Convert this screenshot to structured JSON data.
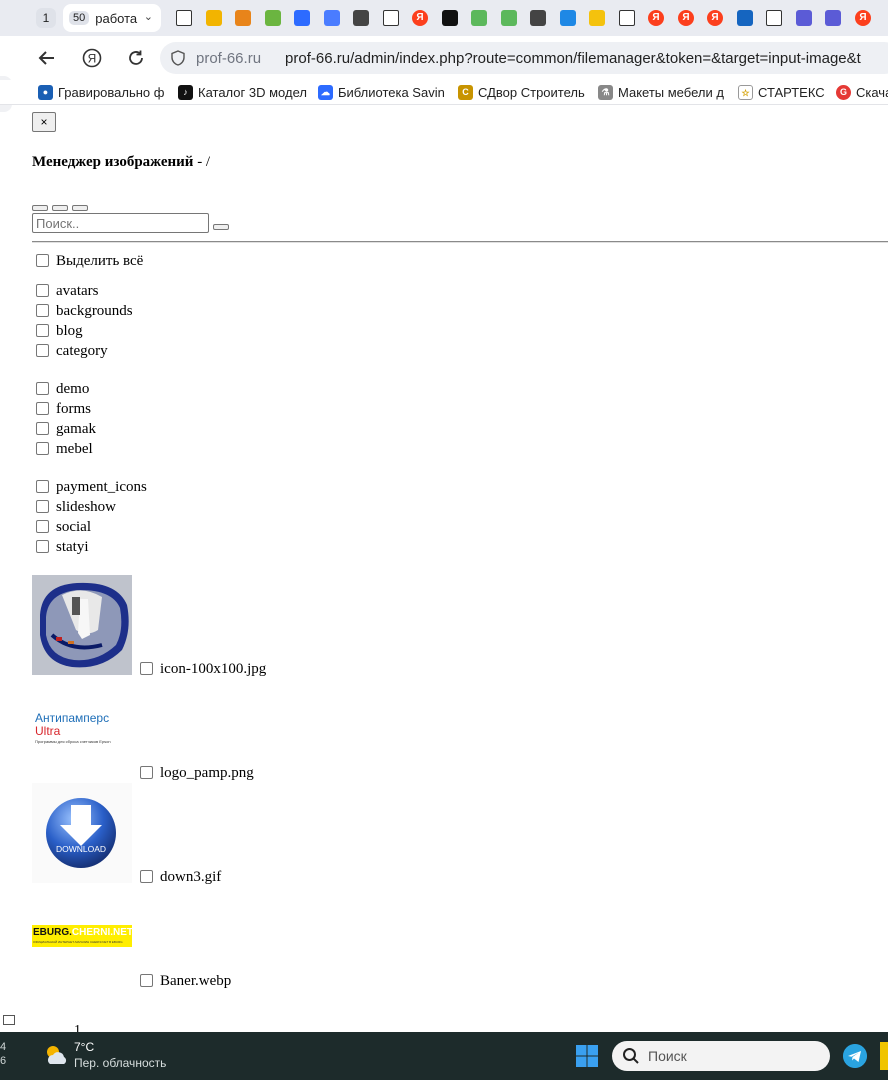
{
  "browser": {
    "tab_count_left": "1",
    "active_tab": {
      "badge": "50",
      "title": "работа"
    },
    "tab_icons": [
      {
        "name": "page-icon",
        "color": "#ffffff"
      },
      {
        "name": "key-icon",
        "color": "#f2b400"
      },
      {
        "name": "orange-app-icon",
        "color": "#e8841a"
      },
      {
        "name": "pacman-icon",
        "color": "#6bb540"
      },
      {
        "name": "blue-app-icon",
        "color": "#2d6bff"
      },
      {
        "name": "blue-square-icon",
        "color": "#4a7cff"
      },
      {
        "name": "prof-icon",
        "color": "#444444"
      },
      {
        "name": "page-icon",
        "color": "#ffffff"
      },
      {
        "name": "yandex-icon",
        "color": "#fc3f1d"
      },
      {
        "name": "vsh-icon",
        "color": "#111111"
      },
      {
        "name": "leaf-icon",
        "color": "#5cb85c"
      },
      {
        "name": "leaf-icon",
        "color": "#5cb85c"
      },
      {
        "name": "prof-icon",
        "color": "#444444"
      },
      {
        "name": "spiral-blue-icon",
        "color": "#1e88e5"
      },
      {
        "name": "spiral-yellow-icon",
        "color": "#f4c20d"
      },
      {
        "name": "page-icon",
        "color": "#ffffff"
      },
      {
        "name": "yandex-icon",
        "color": "#fc3f1d"
      },
      {
        "name": "yandex-icon",
        "color": "#fc3f1d"
      },
      {
        "name": "yandex-icon",
        "color": "#fc3f1d"
      },
      {
        "name": "h-icon",
        "color": "#1565c0"
      },
      {
        "name": "page-icon",
        "color": "#ffffff"
      },
      {
        "name": "purple-app-icon",
        "color": "#5b5bd6"
      },
      {
        "name": "purple-app-icon",
        "color": "#5b5bd6"
      },
      {
        "name": "yandex-icon",
        "color": "#fc3f1d"
      }
    ],
    "url_host": "prof-66.ru",
    "url_path": "prof-66.ru/admin/index.php?route=common/filemanager&token=&target=input-image&t",
    "bookmarks": [
      {
        "label": "Гравировально ф",
        "icon": "logo-icon",
        "color": "#1a5fb4"
      },
      {
        "label": "Каталог 3D модел",
        "icon": "tiktok-icon",
        "color": "#111111"
      },
      {
        "label": "Библиотека Savin",
        "icon": "cloud-icon",
        "color": "#2d6bff"
      },
      {
        "label": "СДвор Строитель",
        "icon": "sdvor-icon",
        "color": "#c89400"
      },
      {
        "label": "Макеты мебели д",
        "icon": "flask-icon",
        "color": "#666666"
      },
      {
        "label": "СТАРТЕКС",
        "icon": "star-icon",
        "color": "#ffffff"
      },
      {
        "label": "Скача",
        "icon": "g-icon",
        "color": "#e53935"
      }
    ]
  },
  "page": {
    "close_label": "×",
    "title_bold": "Менеджер изображений",
    "title_rest": " - /",
    "search_placeholder": "Поиск..",
    "select_all": "Выделить всё",
    "folder_groups": [
      [
        "avatars",
        "backgrounds",
        "blog",
        "category"
      ],
      [
        "demo",
        "forms",
        "gamak",
        "mebel"
      ],
      [
        "payment_icons",
        "slideshow",
        "social",
        "statyi"
      ]
    ],
    "images": [
      {
        "file": "icon-100x100.jpg"
      },
      {
        "file": "logo_pamp.png",
        "logo_line1": "Антипамперс",
        "logo_line2": "Ultra",
        "logo_line3": "Программы для сброса счетчиков Epson"
      },
      {
        "file": "down3.gif",
        "badge": "DOWNLOAD"
      },
      {
        "file": "Baner.webp",
        "banner_a": "EBURG.",
        "banner_b": "CHERNI.NET",
        "banner_sub": "ОФИЦИАЛЬНЫЙ ИНТЕРНЕТ-МАГАЗИН CHERNI.NET В EBURG"
      }
    ],
    "pager": "1"
  },
  "taskbar": {
    "edge_top": "4",
    "edge_bottom": "6",
    "temp": "7°C",
    "weather": "Пер. облачность",
    "search": "Поиск"
  }
}
